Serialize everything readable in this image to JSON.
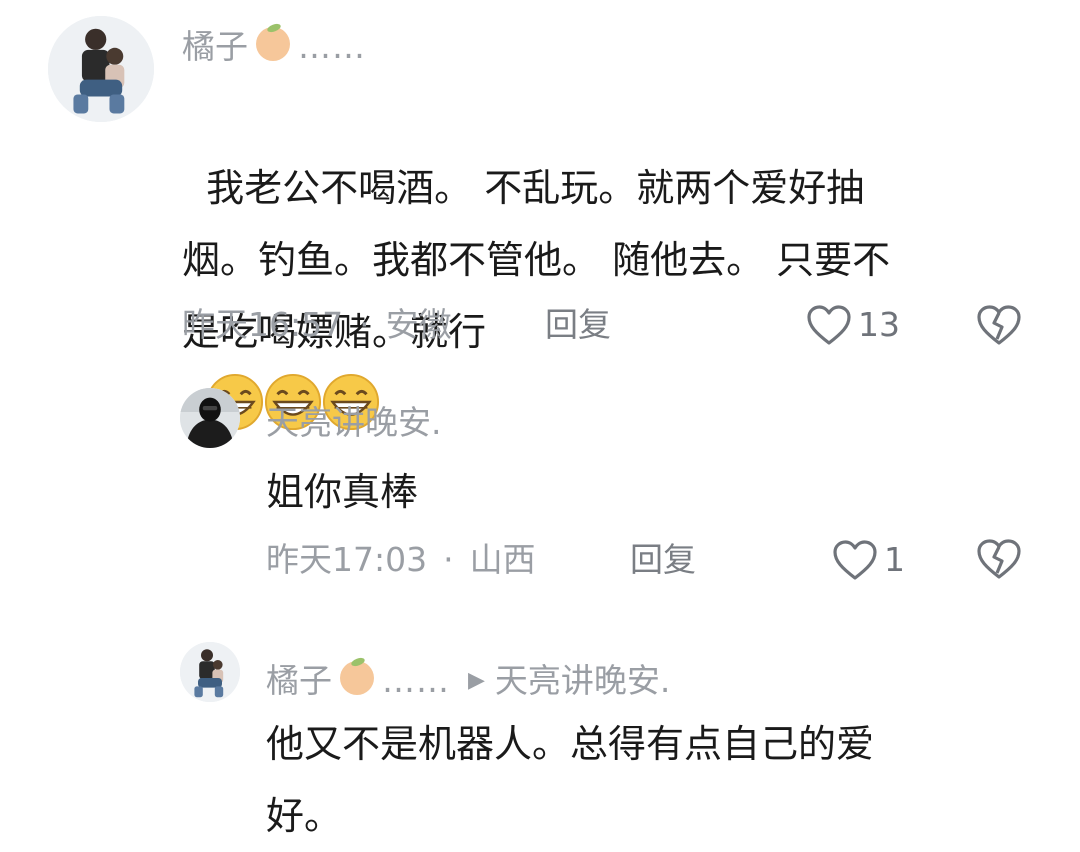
{
  "comments": [
    {
      "author": "橘子",
      "author_dots": "……",
      "avatar": "avatar-couple-photo",
      "text": "我老公不喝酒。 不乱玩。就两个爱好抽\n烟。钓鱼。我都不管他。 随他去。 只要不\n是吃喝嫖赌。就行",
      "emojis": [
        "grinning-face-icon",
        "grinning-face-icon",
        "grinning-face-icon"
      ],
      "time": "昨天16:57",
      "separator": "·",
      "location": "安徽",
      "reply_label": "回复",
      "likes": "13"
    },
    {
      "author": "天亮讲晚安.",
      "avatar": "avatar-dark-figure",
      "text": "姐你真棒",
      "time": "昨天17:03",
      "separator": "·",
      "location": "山西",
      "reply_label": "回复",
      "likes": "1"
    },
    {
      "author": "橘子",
      "author_dots": "……",
      "reply_to": "天亮讲晚安.",
      "avatar": "avatar-couple-photo",
      "text": "他又不是机器人。总得有点自己的爱\n好。"
    }
  ],
  "colors": {
    "meta_gray": "#9a9ea4",
    "text": "#1a1a1a",
    "emoji_yellow": "#f7c948"
  }
}
